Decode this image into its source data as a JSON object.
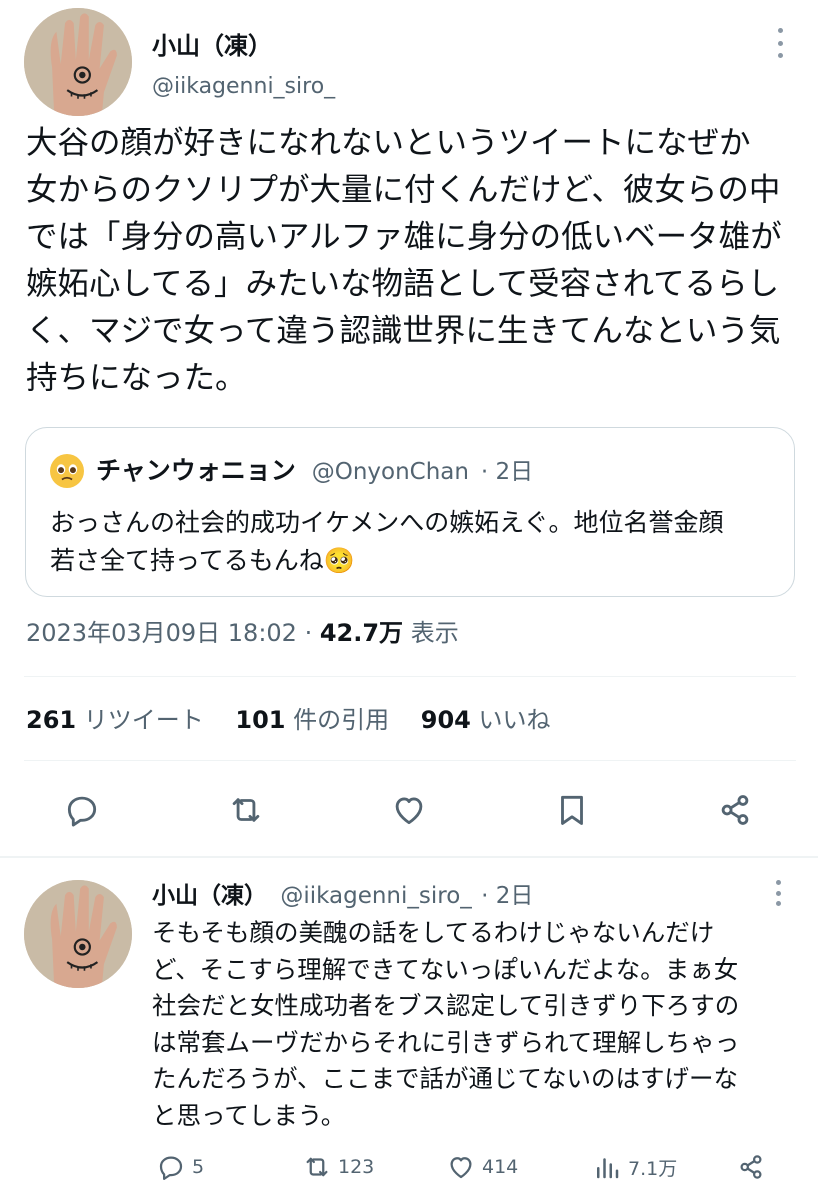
{
  "tweet": {
    "author_name": "小山（凍）",
    "author_handle": "@iikagenni_siro_",
    "text_lines": [
      "大谷の顔が好きになれないというツイートになぜか",
      "女からのクソリプが大量に付くんだけど、彼女らの中",
      "では「身分の高いアルファ雄に身分の低いベータ雄が",
      "嫉妬心してる」みたいな物語として受容されてるらし",
      "く、マジで女って違う認識世界に生きてんなという気",
      "持ちになった。"
    ],
    "quote": {
      "author_name": "チャンウォニョン",
      "author_handle": "@OnyonChan",
      "time": "· 2日",
      "text_lines": [
        "おっさんの社会的成功イケメンへの嫉妬えぐ。地位名誉金顔",
        "若さ全て持ってるもんね🥺"
      ]
    },
    "timestamp": "2023年03月09日 18:02 · ",
    "views": "42.7万",
    "views_label": " 表示",
    "stats": {
      "retweets_count": "261",
      "retweets_label": "リツイート",
      "quotes_count": "101",
      "quotes_label": "件の引用",
      "likes_count": "904",
      "likes_label": "いいね"
    }
  },
  "reply": {
    "author_name": "小山（凍）",
    "author_handle": "@iikagenni_siro_",
    "time": "· 2日",
    "text_lines": [
      "そもそも顔の美醜の話をしてるわけじゃないんだけ",
      "ど、そこすら理解できてないっぽいんだよな。まぁ女",
      "社会だと女性成功者をブス認定して引きずり下ろすの",
      "は常套ムーヴだからそれに引きずられて理解しちゃっ",
      "たんだろうが、ここまで話が通じてないのはすげーな",
      "と思ってしまう。"
    ],
    "replies": "5",
    "retweets": "123",
    "likes": "414",
    "views": "7.1万"
  },
  "icons": {
    "reply": "reply-icon",
    "retweet": "retweet-icon",
    "like": "heart-icon",
    "bookmark": "bookmark-icon",
    "share": "share-icon",
    "views": "analytics-icon",
    "more": "more-icon"
  },
  "colors": {
    "text": "#0f1419",
    "secondary": "#536471",
    "border": "#cfd9de"
  }
}
